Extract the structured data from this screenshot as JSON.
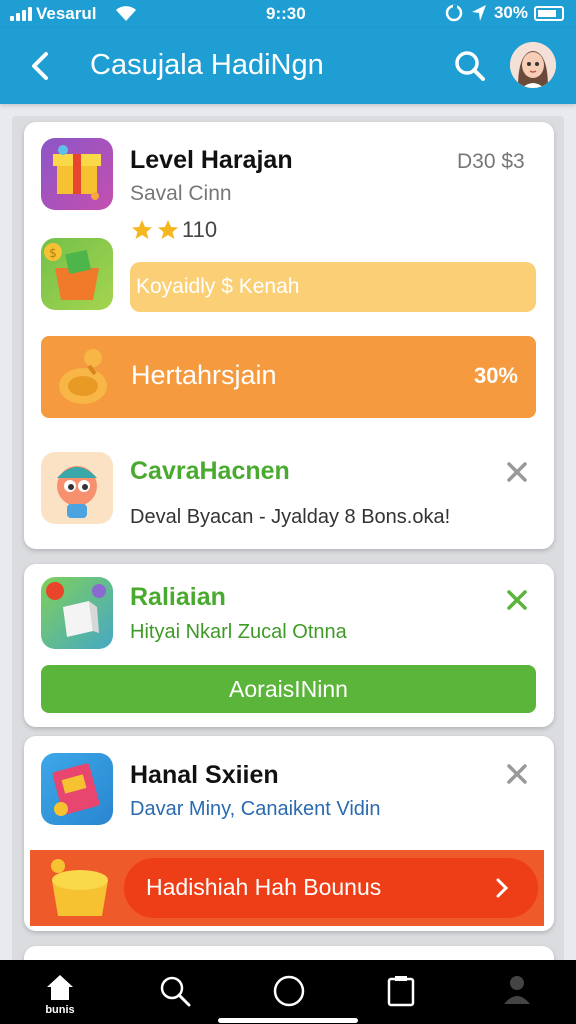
{
  "status_bar": {
    "carrier": "Vesarul",
    "time": "9::30",
    "battery": "30%"
  },
  "app_bar": {
    "title": "Casujala HadiNgn"
  },
  "cards": [
    {
      "title": "Level Harajan",
      "price": "D30 $3",
      "subtitle": "Saval Cinn",
      "rating_count": "110",
      "stars": 2,
      "promo": "Koyaidly $ Kenah",
      "offer_label": "Hertahrsjain",
      "offer_percent": "30%"
    },
    {
      "title": "CavraHacnen",
      "subtitle": "Deval Byacan - Jyalday 8 Bons.oka!"
    },
    {
      "title": "Raliaian",
      "subtitle": "Hityai Nkarl Zucal Otnna",
      "action": "AoraisINinn"
    },
    {
      "title": "Hanal Sxiien",
      "subtitle": "Davar Miny, Canaikent Vidin",
      "banner": "Hadishiah Hah Bounus"
    }
  ],
  "nav": {
    "home_label": "bunis"
  },
  "colors": {
    "primary": "#1e9ed2",
    "orange": "#f59a3e",
    "green": "#5bb53a",
    "red_orange": "#ef4a1c"
  }
}
